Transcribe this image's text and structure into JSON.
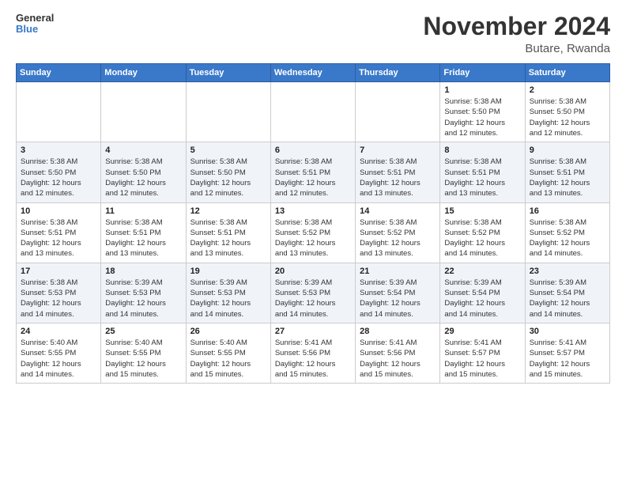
{
  "header": {
    "logo": {
      "line1": "General",
      "line2": "Blue"
    },
    "month": "November 2024",
    "location": "Butare, Rwanda"
  },
  "weekdays": [
    "Sunday",
    "Monday",
    "Tuesday",
    "Wednesday",
    "Thursday",
    "Friday",
    "Saturday"
  ],
  "weeks": [
    [
      {
        "day": "",
        "info": ""
      },
      {
        "day": "",
        "info": ""
      },
      {
        "day": "",
        "info": ""
      },
      {
        "day": "",
        "info": ""
      },
      {
        "day": "",
        "info": ""
      },
      {
        "day": "1",
        "info": "Sunrise: 5:38 AM\nSunset: 5:50 PM\nDaylight: 12 hours\nand 12 minutes."
      },
      {
        "day": "2",
        "info": "Sunrise: 5:38 AM\nSunset: 5:50 PM\nDaylight: 12 hours\nand 12 minutes."
      }
    ],
    [
      {
        "day": "3",
        "info": "Sunrise: 5:38 AM\nSunset: 5:50 PM\nDaylight: 12 hours\nand 12 minutes."
      },
      {
        "day": "4",
        "info": "Sunrise: 5:38 AM\nSunset: 5:50 PM\nDaylight: 12 hours\nand 12 minutes."
      },
      {
        "day": "5",
        "info": "Sunrise: 5:38 AM\nSunset: 5:50 PM\nDaylight: 12 hours\nand 12 minutes."
      },
      {
        "day": "6",
        "info": "Sunrise: 5:38 AM\nSunset: 5:51 PM\nDaylight: 12 hours\nand 12 minutes."
      },
      {
        "day": "7",
        "info": "Sunrise: 5:38 AM\nSunset: 5:51 PM\nDaylight: 12 hours\nand 13 minutes."
      },
      {
        "day": "8",
        "info": "Sunrise: 5:38 AM\nSunset: 5:51 PM\nDaylight: 12 hours\nand 13 minutes."
      },
      {
        "day": "9",
        "info": "Sunrise: 5:38 AM\nSunset: 5:51 PM\nDaylight: 12 hours\nand 13 minutes."
      }
    ],
    [
      {
        "day": "10",
        "info": "Sunrise: 5:38 AM\nSunset: 5:51 PM\nDaylight: 12 hours\nand 13 minutes."
      },
      {
        "day": "11",
        "info": "Sunrise: 5:38 AM\nSunset: 5:51 PM\nDaylight: 12 hours\nand 13 minutes."
      },
      {
        "day": "12",
        "info": "Sunrise: 5:38 AM\nSunset: 5:51 PM\nDaylight: 12 hours\nand 13 minutes."
      },
      {
        "day": "13",
        "info": "Sunrise: 5:38 AM\nSunset: 5:52 PM\nDaylight: 12 hours\nand 13 minutes."
      },
      {
        "day": "14",
        "info": "Sunrise: 5:38 AM\nSunset: 5:52 PM\nDaylight: 12 hours\nand 13 minutes."
      },
      {
        "day": "15",
        "info": "Sunrise: 5:38 AM\nSunset: 5:52 PM\nDaylight: 12 hours\nand 14 minutes."
      },
      {
        "day": "16",
        "info": "Sunrise: 5:38 AM\nSunset: 5:52 PM\nDaylight: 12 hours\nand 14 minutes."
      }
    ],
    [
      {
        "day": "17",
        "info": "Sunrise: 5:38 AM\nSunset: 5:53 PM\nDaylight: 12 hours\nand 14 minutes."
      },
      {
        "day": "18",
        "info": "Sunrise: 5:39 AM\nSunset: 5:53 PM\nDaylight: 12 hours\nand 14 minutes."
      },
      {
        "day": "19",
        "info": "Sunrise: 5:39 AM\nSunset: 5:53 PM\nDaylight: 12 hours\nand 14 minutes."
      },
      {
        "day": "20",
        "info": "Sunrise: 5:39 AM\nSunset: 5:53 PM\nDaylight: 12 hours\nand 14 minutes."
      },
      {
        "day": "21",
        "info": "Sunrise: 5:39 AM\nSunset: 5:54 PM\nDaylight: 12 hours\nand 14 minutes."
      },
      {
        "day": "22",
        "info": "Sunrise: 5:39 AM\nSunset: 5:54 PM\nDaylight: 12 hours\nand 14 minutes."
      },
      {
        "day": "23",
        "info": "Sunrise: 5:39 AM\nSunset: 5:54 PM\nDaylight: 12 hours\nand 14 minutes."
      }
    ],
    [
      {
        "day": "24",
        "info": "Sunrise: 5:40 AM\nSunset: 5:55 PM\nDaylight: 12 hours\nand 14 minutes."
      },
      {
        "day": "25",
        "info": "Sunrise: 5:40 AM\nSunset: 5:55 PM\nDaylight: 12 hours\nand 15 minutes."
      },
      {
        "day": "26",
        "info": "Sunrise: 5:40 AM\nSunset: 5:55 PM\nDaylight: 12 hours\nand 15 minutes."
      },
      {
        "day": "27",
        "info": "Sunrise: 5:41 AM\nSunset: 5:56 PM\nDaylight: 12 hours\nand 15 minutes."
      },
      {
        "day": "28",
        "info": "Sunrise: 5:41 AM\nSunset: 5:56 PM\nDaylight: 12 hours\nand 15 minutes."
      },
      {
        "day": "29",
        "info": "Sunrise: 5:41 AM\nSunset: 5:57 PM\nDaylight: 12 hours\nand 15 minutes."
      },
      {
        "day": "30",
        "info": "Sunrise: 5:41 AM\nSunset: 5:57 PM\nDaylight: 12 hours\nand 15 minutes."
      }
    ]
  ]
}
